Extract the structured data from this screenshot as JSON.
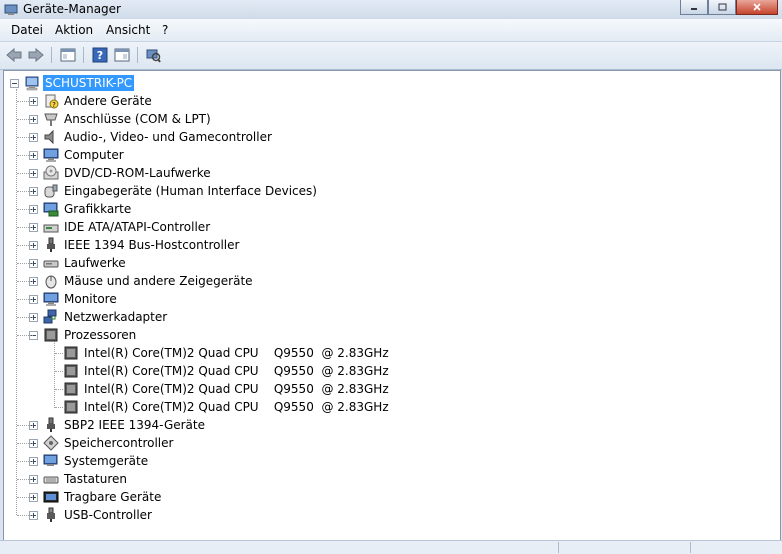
{
  "window": {
    "title": "Geräte-Manager"
  },
  "menu": [
    "Datei",
    "Aktion",
    "Ansicht",
    "?"
  ],
  "toolbar": {
    "icons": [
      "back-arrow-icon",
      "forward-arrow-icon",
      "show-hide-tree-icon",
      "help-icon",
      "properties-icon",
      "scan-hardware-icon"
    ]
  },
  "tree": {
    "root": {
      "label": "SCHUSTRIK-PC",
      "selected": true,
      "icon": "computer-icon"
    },
    "categories": [
      {
        "label": "Andere Geräte",
        "icon": "unknown-device-icon"
      },
      {
        "label": "Anschlüsse (COM & LPT)",
        "icon": "port-icon"
      },
      {
        "label": "Audio-, Video- und Gamecontroller",
        "icon": "speaker-icon"
      },
      {
        "label": "Computer",
        "icon": "monitor-icon"
      },
      {
        "label": "DVD/CD-ROM-Laufwerke",
        "icon": "optical-drive-icon"
      },
      {
        "label": "Eingabegeräte (Human Interface Devices)",
        "icon": "hid-icon"
      },
      {
        "label": "Grafikkarte",
        "icon": "display-adapter-icon"
      },
      {
        "label": "IDE ATA/ATAPI-Controller",
        "icon": "ide-controller-icon"
      },
      {
        "label": "IEEE 1394 Bus-Hostcontroller",
        "icon": "firewire-icon"
      },
      {
        "label": "Laufwerke",
        "icon": "disk-drive-icon"
      },
      {
        "label": "Mäuse und andere Zeigegeräte",
        "icon": "mouse-icon"
      },
      {
        "label": "Monitore",
        "icon": "monitor-icon"
      },
      {
        "label": "Netzwerkadapter",
        "icon": "network-adapter-icon"
      },
      {
        "label": "Prozessoren",
        "icon": "processor-icon",
        "expanded": true,
        "children": [
          "Intel(R) Core(TM)2 Quad CPU    Q9550  @ 2.83GHz",
          "Intel(R) Core(TM)2 Quad CPU    Q9550  @ 2.83GHz",
          "Intel(R) Core(TM)2 Quad CPU    Q9550  @ 2.83GHz",
          "Intel(R) Core(TM)2 Quad CPU    Q9550  @ 2.83GHz"
        ]
      },
      {
        "label": "SBP2 IEEE 1394-Geräte",
        "icon": "firewire-icon"
      },
      {
        "label": "Speichercontroller",
        "icon": "storage-controller-icon"
      },
      {
        "label": "Systemgeräte",
        "icon": "system-device-icon"
      },
      {
        "label": "Tastaturen",
        "icon": "keyboard-icon"
      },
      {
        "label": "Tragbare Geräte",
        "icon": "portable-device-icon"
      },
      {
        "label": "USB-Controller",
        "icon": "usb-icon"
      }
    ]
  }
}
